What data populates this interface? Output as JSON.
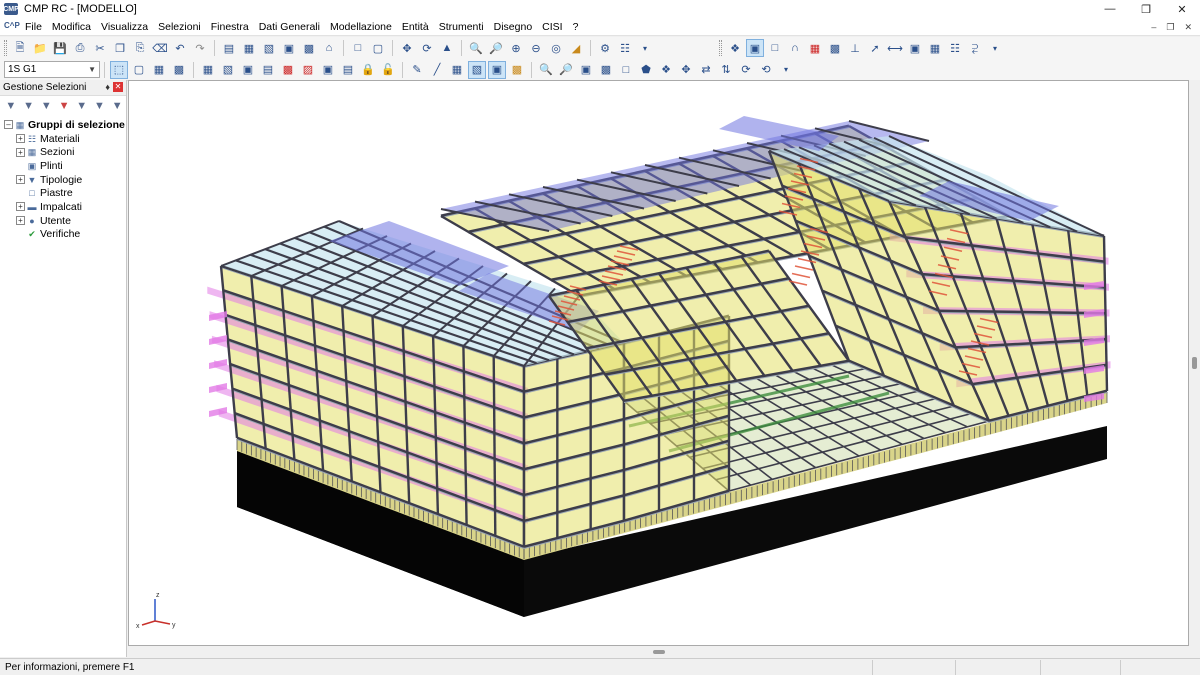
{
  "window": {
    "title": "CMP RC - [MODELLO]",
    "app_badge": "CMP"
  },
  "menu": {
    "logo": "C^P",
    "items": [
      "File",
      "Modifica",
      "Visualizza",
      "Selezioni",
      "Finestra",
      "Dati Generali",
      "Modellazione",
      "Entità",
      "Strumenti",
      "Disegno",
      "CISI",
      "?"
    ]
  },
  "toolbar": {
    "combo_value": "1S G1"
  },
  "panel": {
    "title": "Gestione Selezioni",
    "tree_root": "Gruppi di selezione",
    "tree_items": [
      {
        "label": "Materiali",
        "expandable": true,
        "icon": "materials-icon"
      },
      {
        "label": "Sezioni",
        "expandable": true,
        "icon": "sections-icon"
      },
      {
        "label": "Plinti",
        "expandable": false,
        "icon": "plinth-icon"
      },
      {
        "label": "Tipologie",
        "expandable": true,
        "icon": "type-icon"
      },
      {
        "label": "Piastre",
        "expandable": false,
        "icon": "plate-icon"
      },
      {
        "label": "Impalcati",
        "expandable": true,
        "icon": "floor-icon"
      },
      {
        "label": "Utente",
        "expandable": true,
        "icon": "user-icon"
      },
      {
        "label": "Verifiche",
        "expandable": false,
        "icon": "check-icon"
      }
    ]
  },
  "axes": {
    "x": "x",
    "y": "y",
    "z": "z"
  },
  "status": {
    "text": "Per informazioni, premere F1"
  },
  "colors": {
    "glass_yellow": "#e4e06a",
    "slab_magenta": "#e27ae6",
    "roof_blue": "#6f74e0",
    "beam_dark": "#3d3d4a",
    "foundation": "#0a0a0a",
    "stair_red": "#e0553a",
    "grid_green": "#3f8f3f"
  }
}
